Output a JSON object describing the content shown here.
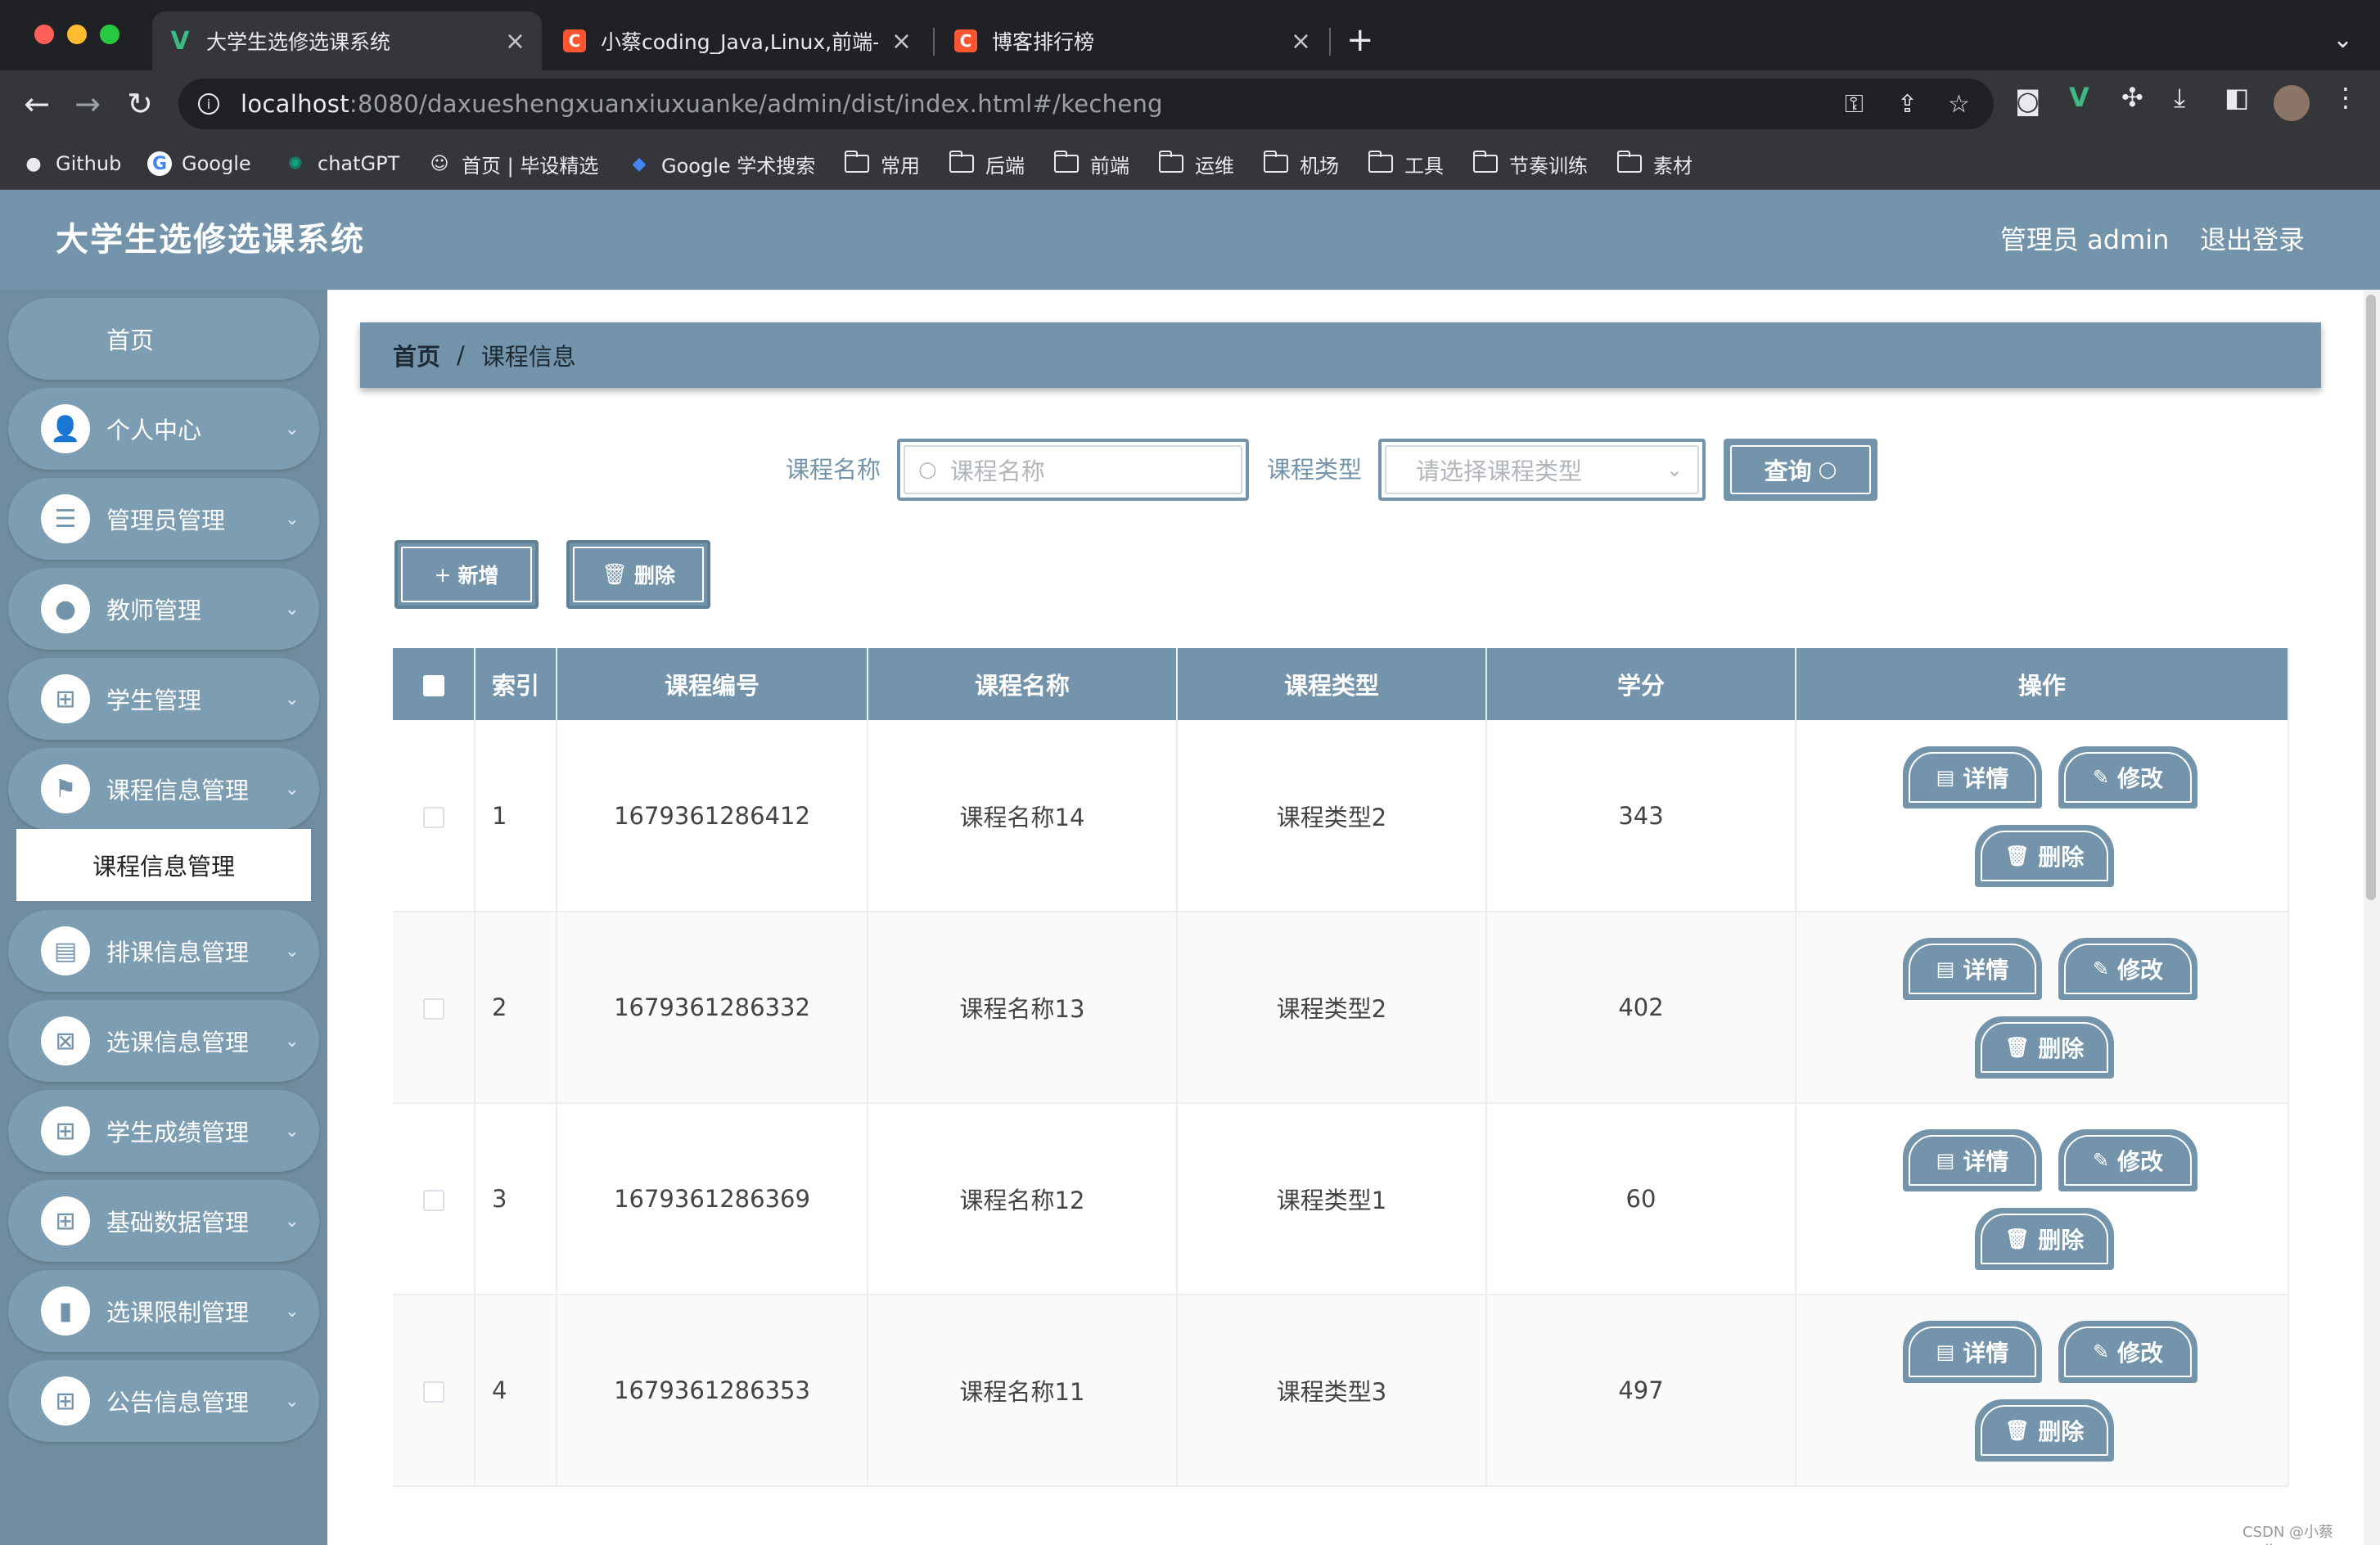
{
  "browser": {
    "tabs": [
      {
        "title": "大学生选修选课系统",
        "active": true,
        "favicon": "vue-icon"
      },
      {
        "title": "小蔡coding_Java,Linux,前端-C",
        "active": false,
        "favicon": "csdn-icon"
      },
      {
        "title": "博客排行榜",
        "active": false,
        "favicon": "csdn-icon"
      }
    ],
    "url_host": "localhost",
    "url_rest": ":8080/daxueshengxuanxiuxuanke/admin/dist/index.html#/kecheng",
    "bookmarks": [
      "Github",
      "Google",
      "chatGPT",
      "首页 | 毕设精选",
      "Google 学术搜索",
      "常用",
      "后端",
      "前端",
      "运维",
      "机场",
      "工具",
      "节奏训练",
      "素材"
    ]
  },
  "app": {
    "title": "大学生选修选课系统",
    "admin_label": "管理员 admin",
    "logout": "退出登录"
  },
  "sidebar": {
    "home": "首页",
    "items": [
      {
        "label": "个人中心",
        "icon": "user-icon"
      },
      {
        "label": "管理员管理",
        "icon": "sliders-icon"
      },
      {
        "label": "教师管理",
        "icon": "bulb-icon"
      },
      {
        "label": "学生管理",
        "icon": "grid-icon"
      },
      {
        "label": "课程信息管理",
        "icon": "flag-icon"
      },
      {
        "label": "排课信息管理",
        "icon": "briefcase-icon"
      },
      {
        "label": "选课信息管理",
        "icon": "clipboard-icon"
      },
      {
        "label": "学生成绩管理",
        "icon": "grid-icon"
      },
      {
        "label": "基础数据管理",
        "icon": "grid-icon"
      },
      {
        "label": "选课限制管理",
        "icon": "book-icon"
      },
      {
        "label": "公告信息管理",
        "icon": "grid-icon"
      }
    ],
    "submenu": "课程信息管理"
  },
  "breadcrumb": {
    "home": "首页",
    "sep": "/",
    "current": "课程信息"
  },
  "search": {
    "name_label": "课程名称",
    "name_placeholder": "课程名称",
    "type_label": "课程类型",
    "type_placeholder": "请选择课程类型",
    "button": "查询"
  },
  "actions": {
    "add": "新增",
    "delete": "删除"
  },
  "table": {
    "headers": [
      "索引",
      "课程编号",
      "课程名称",
      "课程类型",
      "学分",
      "操作"
    ],
    "rows": [
      {
        "index": "1",
        "code": "1679361286412",
        "name": "课程名称14",
        "type": "课程类型2",
        "credit": "343"
      },
      {
        "index": "2",
        "code": "1679361286332",
        "name": "课程名称13",
        "type": "课程类型2",
        "credit": "402"
      },
      {
        "index": "3",
        "code": "1679361286369",
        "name": "课程名称12",
        "type": "课程类型1",
        "credit": "60"
      },
      {
        "index": "4",
        "code": "1679361286353",
        "name": "课程名称11",
        "type": "课程类型3",
        "credit": "497"
      }
    ],
    "op_labels": {
      "detail": "详情",
      "edit": "修改",
      "delete": "删除"
    }
  },
  "watermark": "CSDN @小蔡coding",
  "colors": {
    "primary": "#7394ab",
    "sidebar": "#6f8d9e"
  }
}
